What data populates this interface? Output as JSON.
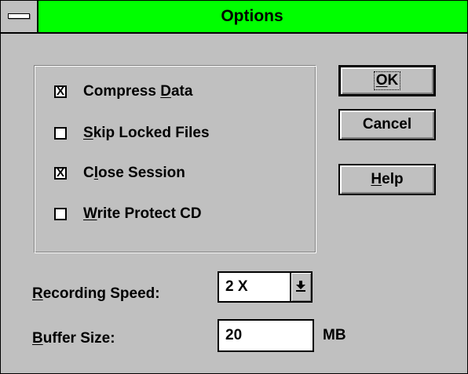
{
  "window": {
    "title": "Options"
  },
  "options": [
    {
      "label_pre": "Compress ",
      "label_key": "D",
      "label_post": "ata",
      "checked": true
    },
    {
      "label_pre": "",
      "label_key": "S",
      "label_post": "kip Locked Files",
      "checked": false
    },
    {
      "label_pre": "C",
      "label_key": "l",
      "label_post": "ose Session",
      "checked": true
    },
    {
      "label_pre": "",
      "label_key": "W",
      "label_post": "rite Protect CD",
      "checked": false
    }
  ],
  "buttons": {
    "ok": {
      "label_pre": "",
      "label_key": "O",
      "label_post": "K"
    },
    "cancel": {
      "label": "Cancel"
    },
    "help": {
      "label_pre": "",
      "label_key": "H",
      "label_post": "elp"
    }
  },
  "recording_speed": {
    "label_key": "R",
    "label_post": "ecording Speed:",
    "value": "2 X",
    "dropdown_icon": "down-arrow-icon"
  },
  "buffer_size": {
    "label_key": "B",
    "label_post": "uffer Size:",
    "value": "20",
    "unit": "MB"
  },
  "colors": {
    "title_bar": "#00ff00",
    "face": "#c0c0c0"
  },
  "check_mark": "X"
}
